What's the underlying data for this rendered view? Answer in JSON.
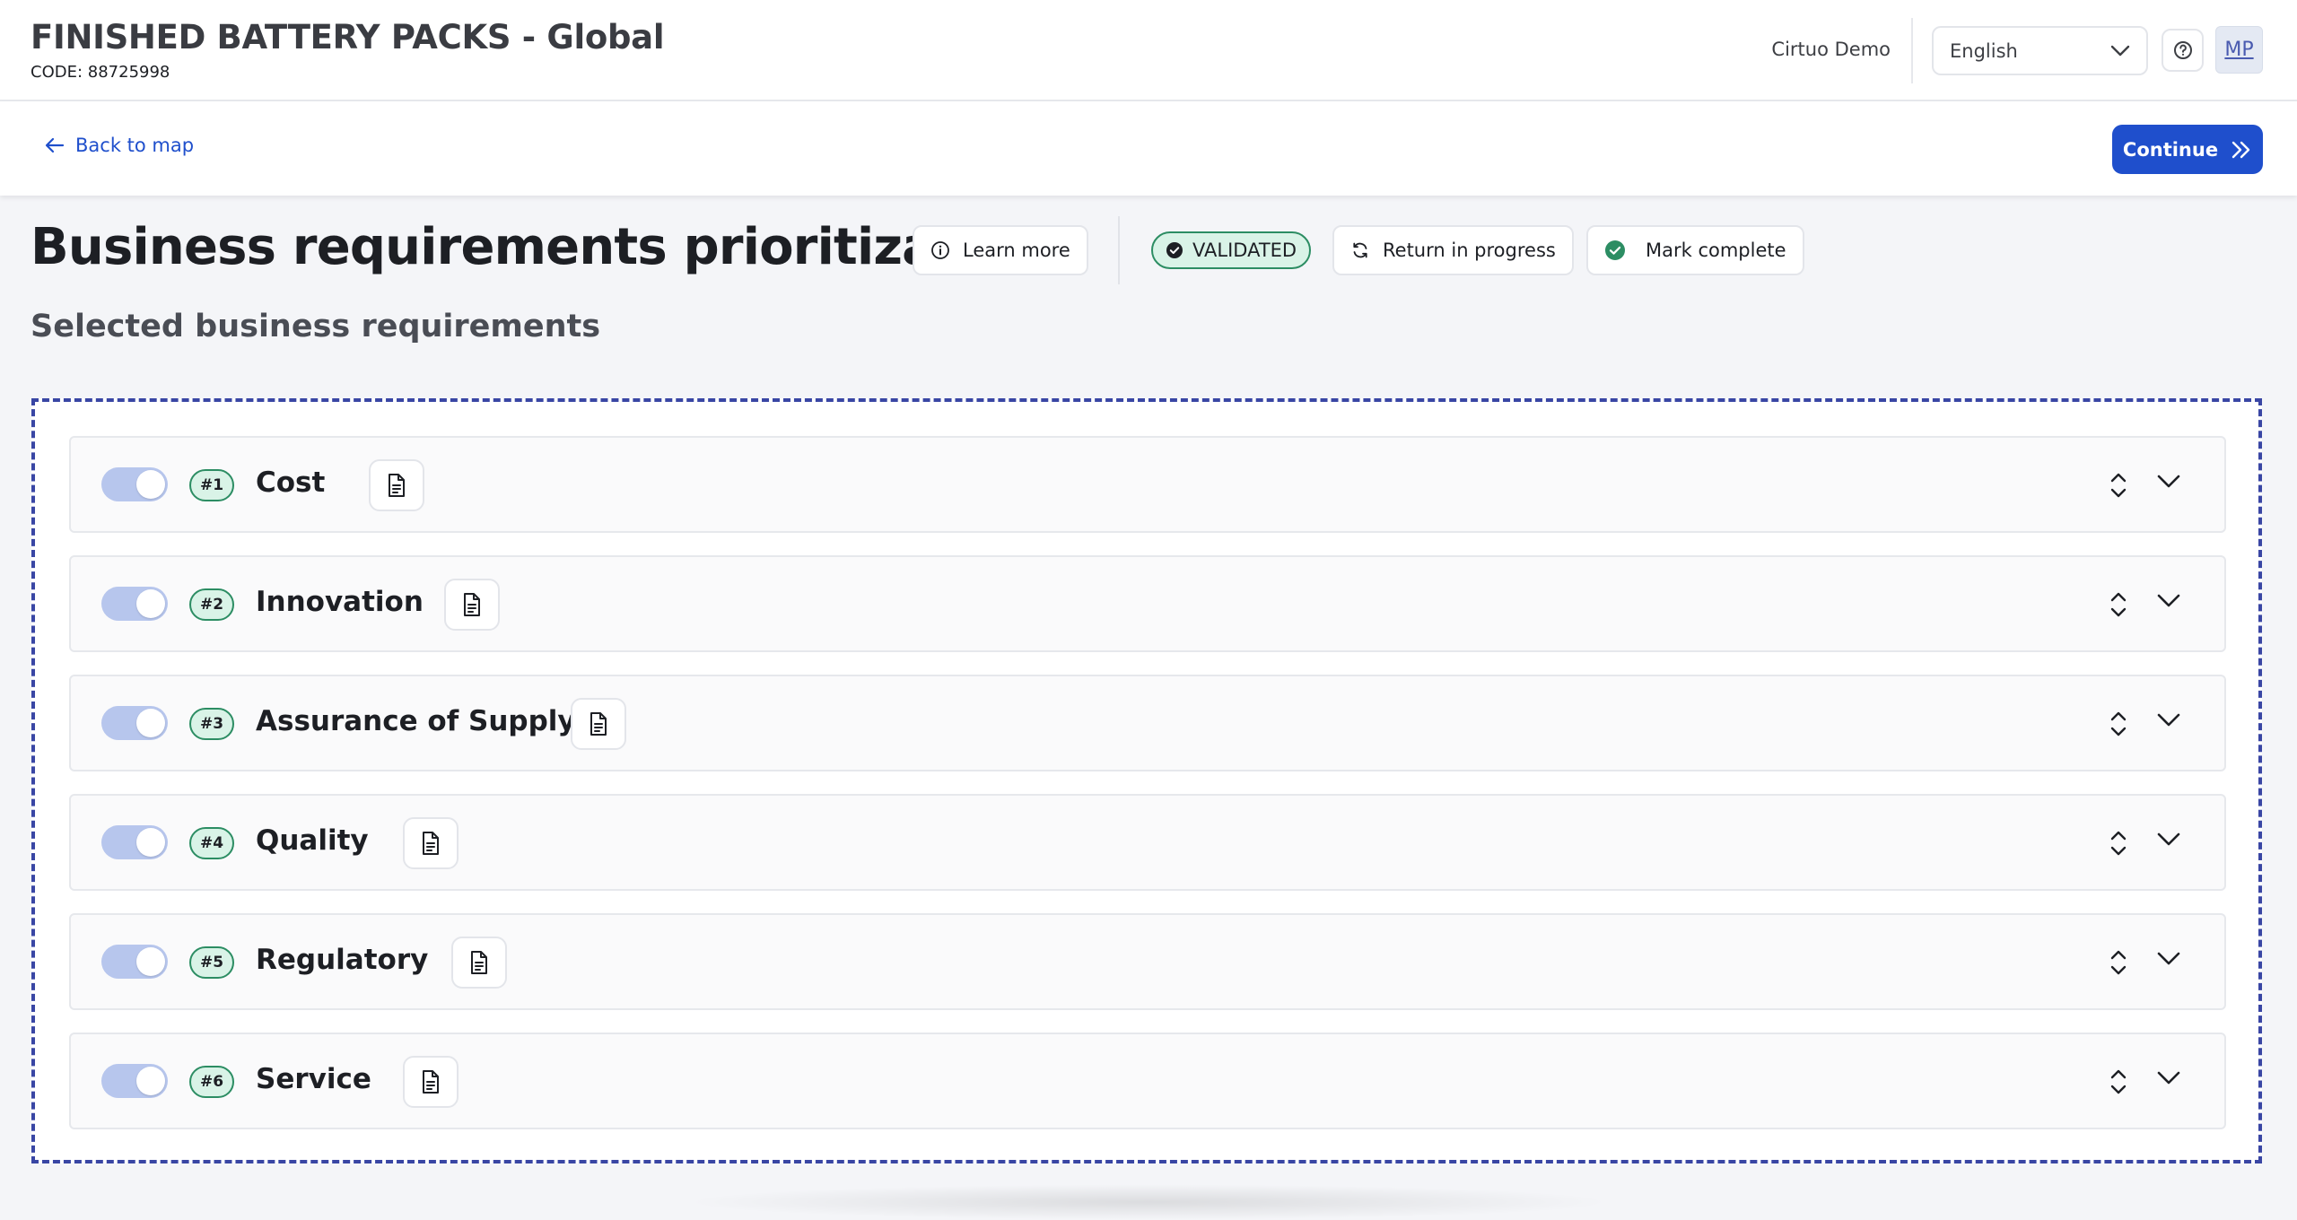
{
  "header": {
    "title": "FINISHED BATTERY PACKS - Global",
    "code": "CODE: 88725998",
    "org": "Cirtuo Demo",
    "language": "English",
    "avatar_initials": "MP"
  },
  "subbar": {
    "back_label": "Back to map",
    "continue_label": "Continue"
  },
  "page": {
    "title": "Business requirements prioritization",
    "learn_more": "Learn more",
    "status": "VALIDATED",
    "return_label": "Return in progress",
    "complete_label": "Mark complete",
    "section_title": "Selected business requirements"
  },
  "requirements": [
    {
      "rank": "#1",
      "label": "Cost",
      "enabled": true
    },
    {
      "rank": "#2",
      "label": "Innovation",
      "enabled": true
    },
    {
      "rank": "#3",
      "label": "Assurance of Supply",
      "enabled": true
    },
    {
      "rank": "#4",
      "label": "Quality",
      "enabled": true
    },
    {
      "rank": "#5",
      "label": "Regulatory",
      "enabled": true
    },
    {
      "rank": "#6",
      "label": "Service",
      "enabled": true
    }
  ],
  "colors": {
    "primary": "#1f4fcc",
    "success": "#2c8d63",
    "success_bg": "#d9f3e7",
    "toggle_on": "#b7c6ed",
    "dropzone_border": "#3946a4"
  },
  "icons": {
    "back": "arrow-left-icon",
    "continue": "double-chevron-right-icon",
    "language": "chevron-down-icon",
    "help": "help-circle-icon",
    "learn_more": "info-icon",
    "validated": "check-circle-icon",
    "return": "refresh-icon",
    "complete": "check-circle-icon",
    "doc": "document-icon",
    "reorder": "sort-icon",
    "expand": "chevron-down-icon"
  }
}
